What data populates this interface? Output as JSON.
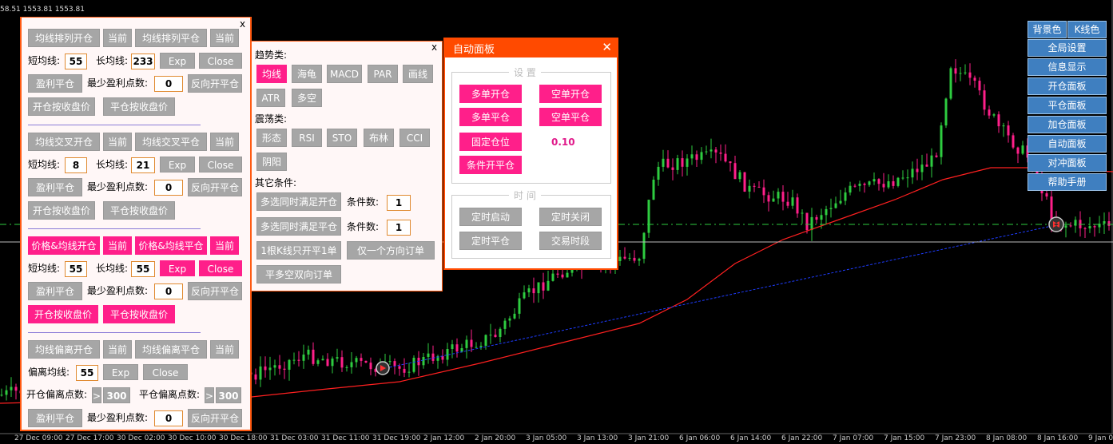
{
  "quote": "58.51 1553.81 1553.81",
  "time_axis": [
    "27 Dec 09:00",
    "27 Dec 17:00",
    "30 Dec 02:00",
    "30 Dec 10:00",
    "30 Dec 18:00",
    "31 Dec 03:00",
    "31 Dec 11:00",
    "31 Dec 19:00",
    "2 Jan 12:00",
    "2 Jan 20:00",
    "3 Jan 05:00",
    "3 Jan 13:00",
    "3 Jan 21:00",
    "6 Jan 06:00",
    "6 Jan 14:00",
    "6 Jan 22:00",
    "7 Jan 07:00",
    "7 Jan 15:00",
    "7 Jan 23:00",
    "8 Jan 08:00",
    "8 Jan 16:00",
    "9 Jan 0"
  ],
  "colors": {
    "bull": "#2ecc40",
    "bear": "#ff1f8a",
    "ma": "#ff2020",
    "trend": "#1e3cff",
    "accent": "#ff5a12",
    "pink": "#ff1f8a",
    "menu": "#3f7fc0"
  },
  "panel1": {
    "close": "x",
    "s1": {
      "open": "均线排列开仓",
      "cur1": "当前",
      "close_btn": "均线排列平仓",
      "cur2": "当前",
      "short_label": "短均线:",
      "short_val": "55",
      "long_label": "长均线:",
      "long_val": "233",
      "exp": "Exp",
      "close": "Close",
      "profit": "盈利平仓",
      "min_label": "最少盈利点数:",
      "min_val": "0",
      "reverse": "反向开平仓",
      "open_close_price": "开仓按收盘价",
      "close_close_price": "平仓按收盘价"
    },
    "s2": {
      "open": "均线交叉开仓",
      "cur1": "当前",
      "close_btn": "均线交叉平仓",
      "cur2": "当前",
      "short_label": "短均线:",
      "short_val": "8",
      "long_label": "长均线:",
      "long_val": "21",
      "exp": "Exp",
      "close": "Close",
      "profit": "盈利平仓",
      "min_label": "最少盈利点数:",
      "min_val": "0",
      "reverse": "反向开平仓",
      "open_close_price": "开仓按收盘价",
      "close_close_price": "平仓按收盘价"
    },
    "s3": {
      "open": "价格&均线开仓",
      "cur1": "当前",
      "close_btn": "价格&均线平仓",
      "cur2": "当前",
      "short_label": "短均线:",
      "short_val": "55",
      "long_label": "长均线:",
      "long_val": "55",
      "exp": "Exp",
      "close": "Close",
      "profit": "盈利平仓",
      "min_label": "最少盈利点数:",
      "min_val": "0",
      "reverse": "反向开平仓",
      "open_close_price": "开仓按收盘价",
      "close_close_price": "平仓按收盘价"
    },
    "s4": {
      "open": "均线偏离开仓",
      "cur1": "当前",
      "close_btn": "均线偏离平仓",
      "cur2": "当前",
      "dev_label": "偏离均线:",
      "dev_val": "55",
      "exp": "Exp",
      "close": "Close",
      "open_dev_label": "开仓偏离点数:",
      "open_dev_arrow": ">",
      "open_dev_val": "300",
      "close_dev_label": "平仓偏离点数:",
      "close_dev_arrow": ">",
      "close_dev_val": "300",
      "profit": "盈利平仓",
      "min_label": "最少盈利点数:",
      "min_val": "0",
      "reverse": "反向开平仓"
    }
  },
  "panel2": {
    "close": "x",
    "trend_label": "趋势类:",
    "trend": [
      "均线",
      "海龟",
      "MACD",
      "PAR",
      "画线",
      "ATR",
      "多空"
    ],
    "osc_label": "震荡类:",
    "osc": [
      "形态",
      "RSI",
      "STO",
      "布林",
      "CCI",
      "阴阳"
    ],
    "other_label": "其它条件:",
    "multi_open": "多选同时满足开仓",
    "cond_label1": "条件数:",
    "cond_val1": "1",
    "multi_close": "多选同时满足平仓",
    "cond_label2": "条件数:",
    "cond_val2": "1",
    "one_bar": "1根K线只开平1单",
    "one_dir": "仅一个方向订单",
    "close_both": "平多空双向订单"
  },
  "panel3": {
    "title": "自动面板",
    "close": "✕",
    "settings_title": "设 置",
    "buy_open": "多单开仓",
    "sell_open": "空单开仓",
    "buy_close": "多单平仓",
    "sell_close": "空单平仓",
    "fixed_lot": "固定仓位",
    "lot_val": "0.10",
    "cond_open_close": "条件开平仓",
    "time_title": "时 间",
    "timer_start": "定时启动",
    "timer_stop": "定时关闭",
    "timer_close": "定时平仓",
    "trade_session": "交易时段"
  },
  "right_menu": {
    "bg_color": "背景色",
    "k_color": "K线色",
    "items": [
      "全局设置",
      "信息显示",
      "开仓面板",
      "平仓面板",
      "加仓面板",
      "自动面板",
      "对冲面板",
      "帮助手册"
    ]
  }
}
